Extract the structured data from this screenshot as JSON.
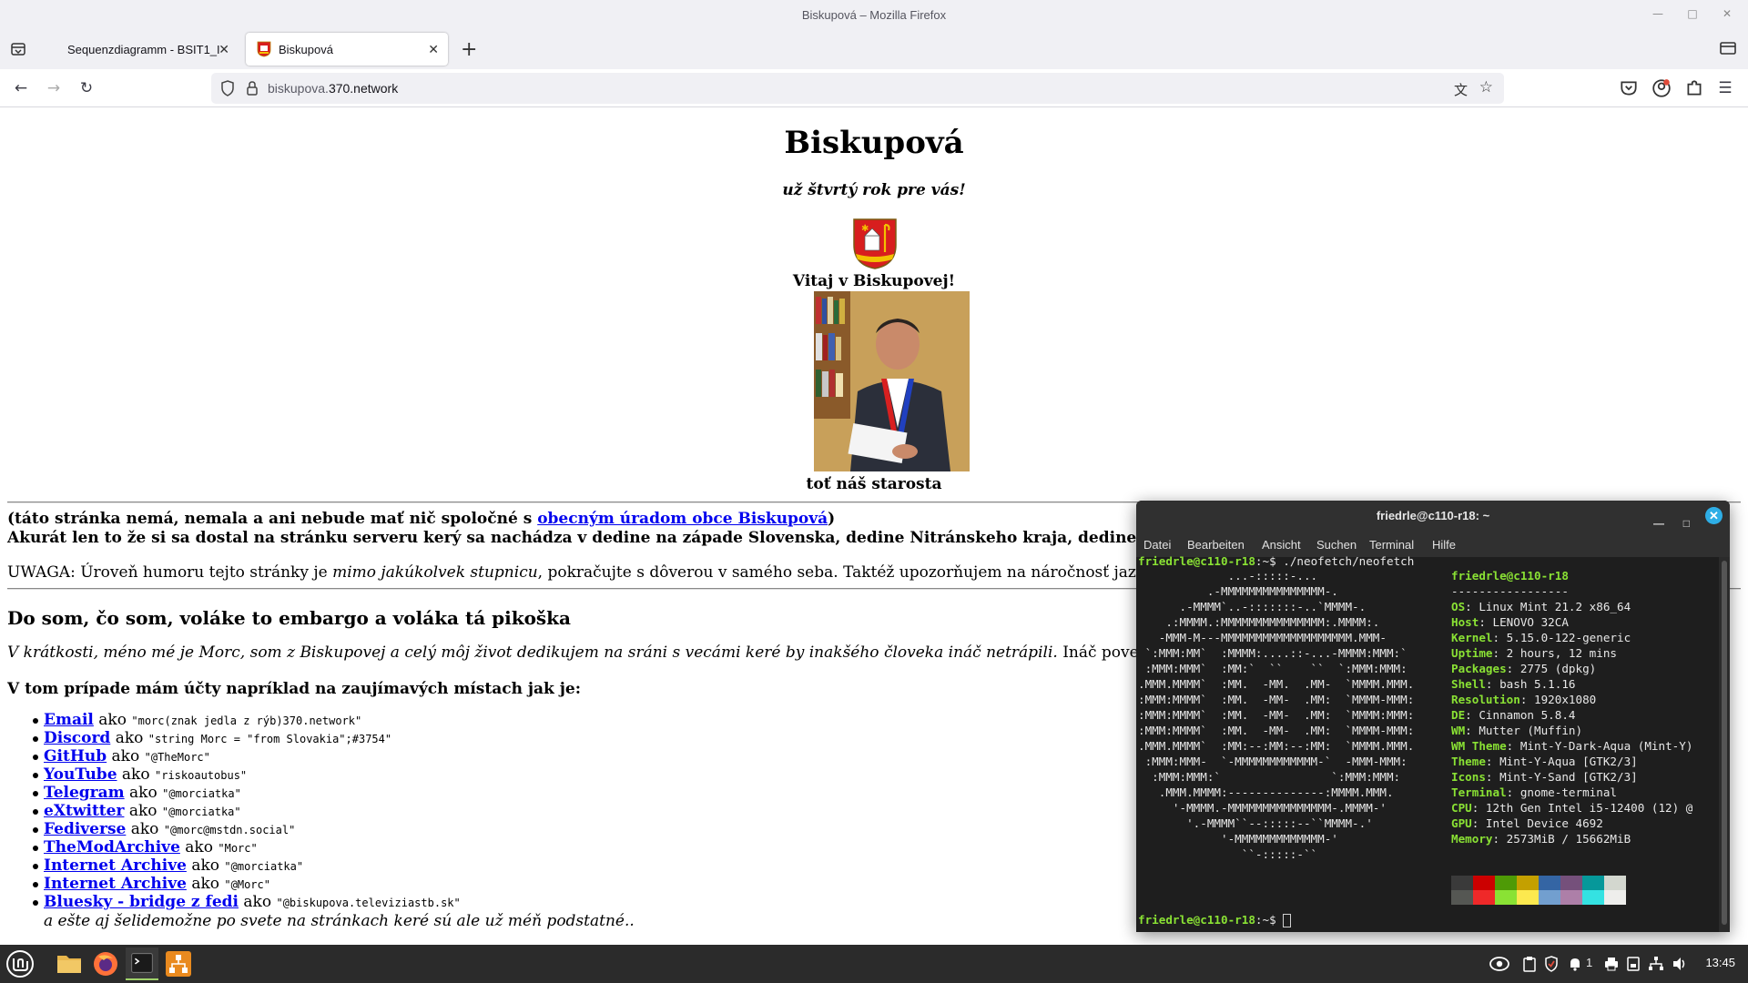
{
  "window": {
    "title": "Biskupová – Mozilla Firefox"
  },
  "tabs": [
    {
      "label": "Sequenzdiagramm - BSIT1_I",
      "active": false
    },
    {
      "label": "Biskupová",
      "active": true
    }
  ],
  "urlbar": {
    "url_prefix": "biskupova.",
    "url_domain": "370.network"
  },
  "page": {
    "title": "Biskupová",
    "subtitle": "už štvrtý rok pre vás!",
    "welcome": "Vitaj v Biskupovej!",
    "mayor_caption": "toť náš starosta",
    "disclaimer_pre": "(táto stránka nemá, nemala a ani nebude mať nič spoločné s ",
    "disclaimer_link": "obecným úradom obce Biskupová",
    "disclaimer_post": ")",
    "disclaimer_line2": "Akurát len to že si sa dostal na stránku serveru kerý sa nachádza v dedine na západe Slovenska, dedine Nitránskeho kraja, dedine v takej ri",
    "warning_pre": "UWAGA: Úroveň humoru tejto stránky je ",
    "warning_ital": "mimo jakúkolvek stupnicu",
    "warning_post": ", pokračujte s dôverou v samého seba. Taktéž upozorňujem na náročnosť jazyka strán",
    "section_title": "Do som, čo som, voláke to embargo a voláka tá pikoška",
    "intro_ital": "V krátkosti, méno mé je Morc, som z Biskupovej a celý môj život dedikujem na sráni s vecámi keré by inakšého človeka ináč netrápili.",
    "intro_post": " Ináč povedané, rok",
    "accounts_title": "V tom prípade mám účty napríklad na zaujímavých místach jak je:",
    "accounts": [
      {
        "service": "Email",
        "handle": "\"morc(znak jedla z rýb)370.network\""
      },
      {
        "service": "Discord",
        "handle": "\"string Morc = \"from Slovakia\";#3754\""
      },
      {
        "service": "GitHub",
        "handle": "\"@TheMorc\""
      },
      {
        "service": "YouTube",
        "handle": "\"riskoautobus\""
      },
      {
        "service": "Telegram",
        "handle": "\"@morciatka\""
      },
      {
        "service": "eXtwitter",
        "handle": "\"@morciatka\""
      },
      {
        "service": "Fediverse",
        "handle": "\"@morc@mstdn.social\""
      },
      {
        "service": "TheModArchive",
        "handle": "\"Morc\""
      },
      {
        "service": "Internet Archive",
        "handle": "\"@morciatka\""
      },
      {
        "service": "Internet Archive",
        "handle": "\"@Morc\""
      },
      {
        "service": "Bluesky - bridge z fedi",
        "handle": "\"@biskupova.televiziastb.sk\""
      }
    ],
    "accounts_word": "ako",
    "accounts_tail": "a ešte aj šelidemožne po svete na stránkach keré sú ale už méň podstatné.."
  },
  "terminal": {
    "title": "friedrle@c110-r18: ~",
    "menu": [
      "Datei",
      "Bearbeiten",
      "Ansicht",
      "Suchen",
      "Terminal",
      "Hilfe"
    ],
    "prompt_user": "friedrle@c110-r18",
    "prompt_path": ":~$ ",
    "command": "./neofetch/neofetch",
    "info_header": "friedrle@c110-r18",
    "info_sep": "-----------------",
    "info": [
      {
        "k": "OS",
        "v": "Linux Mint 21.2 x86_64"
      },
      {
        "k": "Host",
        "v": "LENOVO 32CA"
      },
      {
        "k": "Kernel",
        "v": "5.15.0-122-generic"
      },
      {
        "k": "Uptime",
        "v": "2 hours, 12 mins"
      },
      {
        "k": "Packages",
        "v": "2775 (dpkg)"
      },
      {
        "k": "Shell",
        "v": "bash 5.1.16"
      },
      {
        "k": "Resolution",
        "v": "1920x1080"
      },
      {
        "k": "DE",
        "v": "Cinnamon 5.8.4"
      },
      {
        "k": "WM",
        "v": "Mutter (Muffin)"
      },
      {
        "k": "WM Theme",
        "v": "Mint-Y-Dark-Aqua (Mint-Y)"
      },
      {
        "k": "Theme",
        "v": "Mint-Y-Aqua [GTK2/3]"
      },
      {
        "k": "Icons",
        "v": "Mint-Y-Sand [GTK2/3]"
      },
      {
        "k": "Terminal",
        "v": "gnome-terminal"
      },
      {
        "k": "CPU",
        "v": "12th Gen Intel i5-12400 (12) @"
      },
      {
        "k": "GPU",
        "v": "Intel Device 4692"
      },
      {
        "k": "Memory",
        "v": "2573MiB / 15662MiB"
      }
    ],
    "ascii_art": [
      "             ...-:::::-...",
      "          .-MMMMMMMMMMMMMMM-.",
      "      .-MMMM`..-:::::::-..`MMMM-.",
      "    .:MMMM.:MMMMMMMMMMMMMMM:.MMMM:.",
      "   -MMM-M---MMMMMMMMMMMMMMMMMMM.MMM-",
      " `:MMM:MM`  :MMMM:....::-...-MMMM:MMM:`",
      " :MMM:MMM`  :MM:`  ``    ``  `:MMM:MMM:",
      ".MMM.MMMM`  :MM.  -MM.  .MM-  `MMMM.MMM.",
      ":MMM:MMMM`  :MM.  -MM-  .MM:  `MMMM-MMM:",
      ":MMM:MMMM`  :MM.  -MM-  .MM:  `MMMM:MMM:",
      ":MMM:MMMM`  :MM.  -MM-  .MM:  `MMMM-MMM:",
      ".MMM.MMMM`  :MM:--:MM:--:MM:  `MMMM.MMM.",
      " :MMM:MMM-  `-MMMMMMMMMMMM-`  -MMM-MMM:",
      "  :MMM:MMM:`                `:MMM:MMM:",
      "   .MMM.MMMM:--------------:MMMM.MMM.",
      "     '-MMMM.-MMMMMMMMMMMMMMM-.MMMM-'",
      "       '.-MMMM``--:::::--``MMMM-.'",
      "            '-MMMMMMMMMMMMM-'",
      "               ``-:::::-``"
    ],
    "palette_top": [
      "#3a3a3a",
      "#cc0000",
      "#4e9a06",
      "#c4a000",
      "#3465a4",
      "#75507b",
      "#06989a",
      "#d3d7cf"
    ],
    "palette_bottom": [
      "#555753",
      "#ef2929",
      "#8ae234",
      "#fce94f",
      "#729fcf",
      "#ad7fa8",
      "#34e2e2",
      "#eeeeec"
    ]
  },
  "taskbar": {
    "tray_badge": "1",
    "clock": "13:45"
  },
  "colors": {
    "link": "#0000ee",
    "term_green": "#8ae234",
    "accent": "#2eaee6"
  }
}
